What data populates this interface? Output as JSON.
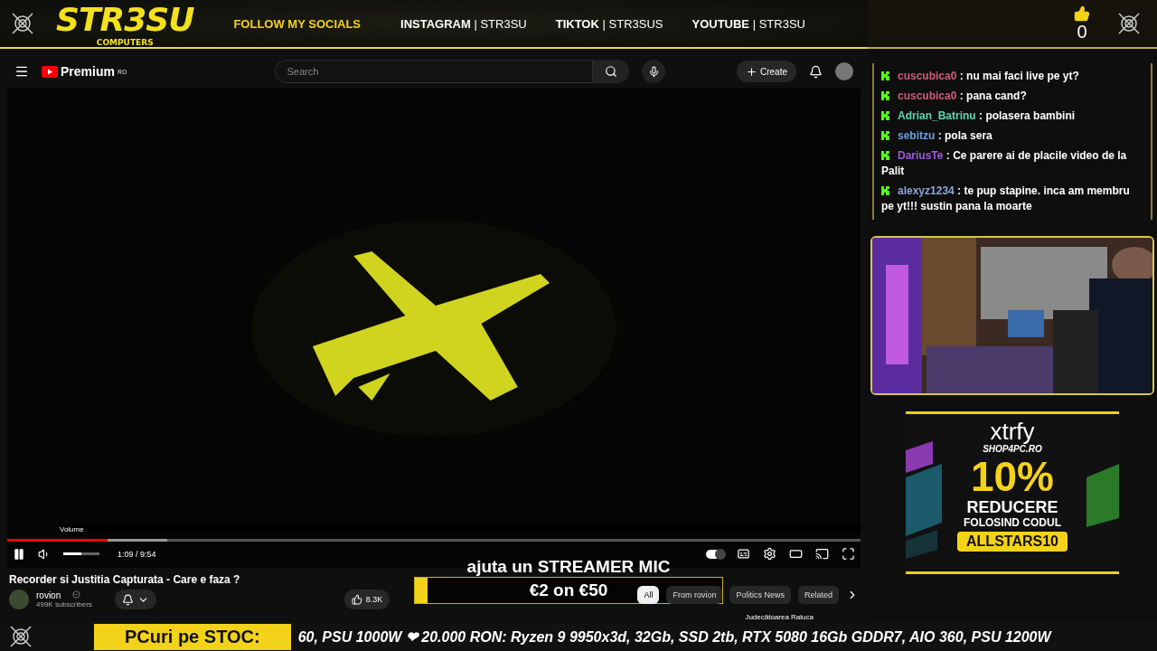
{
  "overlay": {
    "logo": "STR3SU",
    "logo_sub": "COMPUTERS",
    "follow": "FOLLOW MY SOCIALS",
    "socials": [
      {
        "network": "INSTAGRAM",
        "separator": "|",
        "handle": "STR3SU"
      },
      {
        "network": "TIKTOK",
        "separator": "|",
        "handle": "STR3SUS"
      },
      {
        "network": "YOUTUBE",
        "separator": "|",
        "handle": "STR3SU"
      }
    ],
    "likes": "0"
  },
  "youtube": {
    "brand": "Premium",
    "region": "RO",
    "search": {
      "placeholder": "Search"
    },
    "create": "Create"
  },
  "player": {
    "tooltip": "Volume",
    "progress": {
      "level": 0.118
    },
    "buffer": {
      "level": 0.187
    },
    "volume": {
      "level": 0.5
    },
    "time": "1:09 / 9:54",
    "autoplay": true
  },
  "video": {
    "title": "Recorder si Justitia Capturata - Care e faza ?",
    "channel": "rovion",
    "subscribers": "499K subscribers",
    "likes": "8.3K"
  },
  "chips": [
    {
      "label": "All",
      "selected": true
    },
    {
      "label": "From rovion",
      "selected": false
    },
    {
      "label": "Politics News",
      "selected": false
    },
    {
      "label": "Related",
      "selected": false
    }
  ],
  "recommendation": {
    "title": "Judecătoarea Raluca"
  },
  "goal": {
    "caption": "ajuta un STREAMER MIC",
    "progress": "€2 on €50",
    "level": 0.04
  },
  "chat": [
    {
      "user": "cuscubica0",
      "color": "#d05a7a",
      "separator": ":",
      "text": "nu mai faci live pe yt?"
    },
    {
      "user": "cuscubica0",
      "color": "#d05a7a",
      "separator": ":",
      "text": "pana cand?"
    },
    {
      "user": "Adrian_Batrinu",
      "color": "#5ed6b0",
      "separator": ":",
      "text": "polasera bambini"
    },
    {
      "user": "sebitzu",
      "color": "#6f9ee0",
      "separator": ":",
      "text": "pola sera"
    },
    {
      "user": "DariusTe",
      "color": "#a15ae0",
      "separator": ":",
      "text": "Ce parere ai de placile video de la Palit"
    },
    {
      "user": "alexyz1234",
      "color": "#8aa6d8",
      "separator": ":",
      "text": "te pup stapine. inca am membru pe yt!!! sustin pana la moarte"
    }
  ],
  "ad": {
    "brand": "xtrfy",
    "shop": "SHOP4PC.RO",
    "discount": "10%",
    "line1": "REDUCERE",
    "line2": "FOLOSIND CODUL",
    "code": "ALLSTARS10"
  },
  "ticker": {
    "label": "PCuri pe STOC:",
    "text": "60, PSU 1000W ❤ 20.000 RON: Ryzen 9 9950x3d, 32Gb, SSD 2tb, RTX 5080 16Gb GDDR7, AIO 360, PSU 1200W"
  }
}
